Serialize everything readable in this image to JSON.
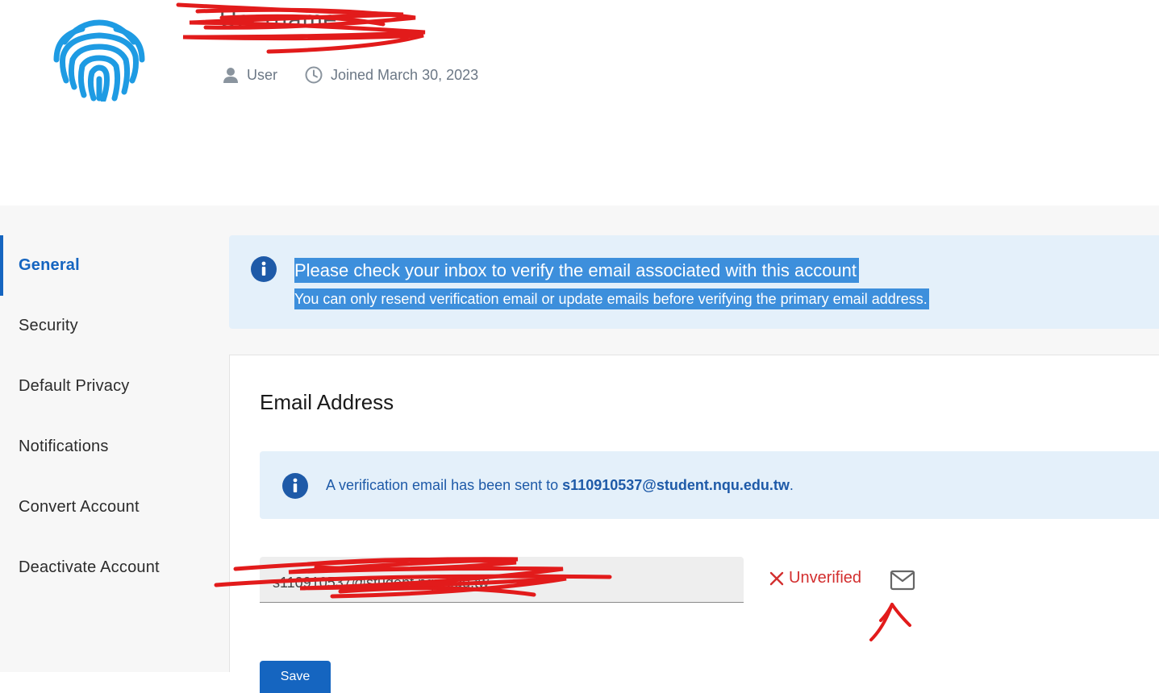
{
  "header": {
    "username": "Username",
    "role": "User",
    "joined": "Joined March 30, 2023"
  },
  "sidebar": {
    "items": [
      {
        "label": "General",
        "active": true
      },
      {
        "label": "Security"
      },
      {
        "label": "Default Privacy"
      },
      {
        "label": "Notifications"
      },
      {
        "label": "Convert Account"
      },
      {
        "label": "Deactivate Account"
      }
    ]
  },
  "top_alert": {
    "title": "Please check your inbox to verify the email associated with this account",
    "body": "You can only resend verification email or update emails before verifying the primary email address."
  },
  "email_card": {
    "title": "Email Address",
    "notice_prefix": "A verification email has been sent to ",
    "notice_email": "s110910537@student.nqu.edu.tw",
    "notice_suffix": ".",
    "field_value": "s110910537@student.nqu.edu.tw",
    "status_label": "Unverified",
    "save_label": "Save"
  },
  "colors": {
    "accent": "#1565c0",
    "alert_bg": "#e4f0fa",
    "selection": "#3d8fdc",
    "error": "#d32f2f",
    "annotation": "#e21b1b"
  },
  "icons": {
    "avatar": "fingerprint-icon",
    "role": "user-icon",
    "joined": "clock-icon",
    "info": "info-icon",
    "status": "close-icon",
    "resend": "mail-icon"
  }
}
